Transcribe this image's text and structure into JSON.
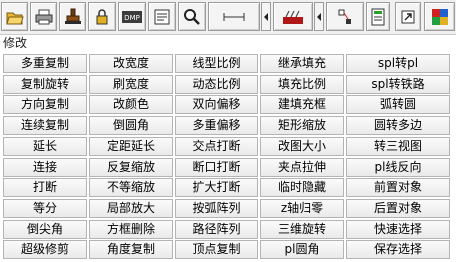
{
  "toolbar": {
    "buttons": [
      {
        "icon": "open-folder-icon"
      },
      {
        "icon": "printer-icon"
      },
      {
        "icon": "stamp-icon"
      },
      {
        "icon": "lock-icon"
      },
      {
        "icon": "dmp-icon",
        "text": "DMP"
      },
      {
        "icon": "text-panel-icon"
      },
      {
        "icon": "zoom-icon"
      },
      {
        "icon": "dimension-icon"
      },
      {
        "icon": "hatch-pattern-icon"
      },
      {
        "icon": "node-link-icon"
      },
      {
        "icon": "text-block-icon"
      },
      {
        "icon": "pointer-arrow-icon"
      },
      {
        "icon": "color-grid-icon"
      }
    ],
    "arrow_icon": "scroll-left-arrow-icon",
    "accent": "#c81e1e"
  },
  "group_label": "修改",
  "rows": [
    [
      "多重复制",
      "改宽度",
      "线型比例",
      "继承填充",
      "spl转pl"
    ],
    [
      "复制旋转",
      "刷宽度",
      "动态比例",
      "填充比例",
      "spl转铁路"
    ],
    [
      "方向复制",
      "改颜色",
      "双向偏移",
      "建填充框",
      "弧转圆"
    ],
    [
      "连续复制",
      "倒圆角",
      "多重偏移",
      "矩形缩放",
      "圆转多边"
    ],
    [
      "延长",
      "定距延长",
      "交点打断",
      "改图大小",
      "转三视图"
    ],
    [
      "连接",
      "反复缩放",
      "断口打断",
      "夹点拉伸",
      "pl线反向"
    ],
    [
      "打断",
      "不等缩放",
      "扩大打断",
      "临时隐藏",
      "前置对象"
    ],
    [
      "等分",
      "局部放大",
      "按弧阵列",
      "z轴归零",
      "后置对象"
    ],
    [
      "倒尖角",
      "方框删除",
      "路径阵列",
      "三维旋转",
      "快速选择"
    ],
    [
      "超级修剪",
      "角度复制",
      "顶点复制",
      "pl圆角",
      "保存选择"
    ]
  ]
}
